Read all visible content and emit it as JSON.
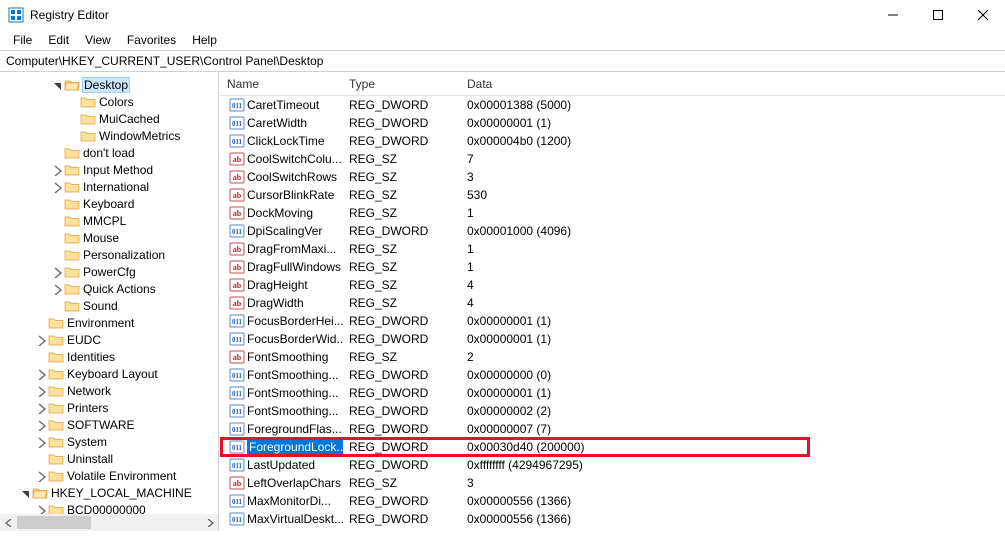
{
  "window": {
    "title": "Registry Editor"
  },
  "menu": {
    "file": "File",
    "edit": "Edit",
    "view": "View",
    "favorites": "Favorites",
    "help": "Help"
  },
  "address": "Computer\\HKEY_CURRENT_USER\\Control Panel\\Desktop",
  "list_header": {
    "name": "Name",
    "type": "Type",
    "data": "Data"
  },
  "tree": [
    {
      "depth": 3,
      "label": "Desktop",
      "expand": "open",
      "sel": true
    },
    {
      "depth": 4,
      "label": "Colors",
      "expand": ""
    },
    {
      "depth": 4,
      "label": "MuiCached",
      "expand": ""
    },
    {
      "depth": 4,
      "label": "WindowMetrics",
      "expand": ""
    },
    {
      "depth": 3,
      "label": "don't load",
      "expand": ""
    },
    {
      "depth": 3,
      "label": "Input Method",
      "expand": "closed"
    },
    {
      "depth": 3,
      "label": "International",
      "expand": "closed"
    },
    {
      "depth": 3,
      "label": "Keyboard",
      "expand": ""
    },
    {
      "depth": 3,
      "label": "MMCPL",
      "expand": ""
    },
    {
      "depth": 3,
      "label": "Mouse",
      "expand": ""
    },
    {
      "depth": 3,
      "label": "Personalization",
      "expand": ""
    },
    {
      "depth": 3,
      "label": "PowerCfg",
      "expand": "closed"
    },
    {
      "depth": 3,
      "label": "Quick Actions",
      "expand": "closed"
    },
    {
      "depth": 3,
      "label": "Sound",
      "expand": ""
    },
    {
      "depth": 2,
      "label": "Environment",
      "expand": ""
    },
    {
      "depth": 2,
      "label": "EUDC",
      "expand": "closed"
    },
    {
      "depth": 2,
      "label": "Identities",
      "expand": ""
    },
    {
      "depth": 2,
      "label": "Keyboard Layout",
      "expand": "closed"
    },
    {
      "depth": 2,
      "label": "Network",
      "expand": "closed"
    },
    {
      "depth": 2,
      "label": "Printers",
      "expand": "closed"
    },
    {
      "depth": 2,
      "label": "SOFTWARE",
      "expand": "closed"
    },
    {
      "depth": 2,
      "label": "System",
      "expand": "closed"
    },
    {
      "depth": 2,
      "label": "Uninstall",
      "expand": ""
    },
    {
      "depth": 2,
      "label": "Volatile Environment",
      "expand": "closed"
    },
    {
      "depth": 1,
      "label": "HKEY_LOCAL_MACHINE",
      "expand": "open"
    },
    {
      "depth": 2,
      "label": "BCD00000000",
      "expand": "closed",
      "cut": true
    }
  ],
  "values": [
    {
      "icon": "bin",
      "name": "CaretTimeout",
      "type": "REG_DWORD",
      "data": "0x00001388 (5000)"
    },
    {
      "icon": "bin",
      "name": "CaretWidth",
      "type": "REG_DWORD",
      "data": "0x00000001 (1)"
    },
    {
      "icon": "bin",
      "name": "ClickLockTime",
      "type": "REG_DWORD",
      "data": "0x000004b0 (1200)"
    },
    {
      "icon": "str",
      "name": "CoolSwitchColu...",
      "type": "REG_SZ",
      "data": "7"
    },
    {
      "icon": "str",
      "name": "CoolSwitchRows",
      "type": "REG_SZ",
      "data": "3"
    },
    {
      "icon": "str",
      "name": "CursorBlinkRate",
      "type": "REG_SZ",
      "data": "530"
    },
    {
      "icon": "str",
      "name": "DockMoving",
      "type": "REG_SZ",
      "data": "1"
    },
    {
      "icon": "bin",
      "name": "DpiScalingVer",
      "type": "REG_DWORD",
      "data": "0x00001000 (4096)"
    },
    {
      "icon": "str",
      "name": "DragFromMaxi...",
      "type": "REG_SZ",
      "data": "1"
    },
    {
      "icon": "str",
      "name": "DragFullWindows",
      "type": "REG_SZ",
      "data": "1"
    },
    {
      "icon": "str",
      "name": "DragHeight",
      "type": "REG_SZ",
      "data": "4"
    },
    {
      "icon": "str",
      "name": "DragWidth",
      "type": "REG_SZ",
      "data": "4"
    },
    {
      "icon": "bin",
      "name": "FocusBorderHei...",
      "type": "REG_DWORD",
      "data": "0x00000001 (1)"
    },
    {
      "icon": "bin",
      "name": "FocusBorderWid...",
      "type": "REG_DWORD",
      "data": "0x00000001 (1)"
    },
    {
      "icon": "str",
      "name": "FontSmoothing",
      "type": "REG_SZ",
      "data": "2"
    },
    {
      "icon": "bin",
      "name": "FontSmoothing...",
      "type": "REG_DWORD",
      "data": "0x00000000 (0)"
    },
    {
      "icon": "bin",
      "name": "FontSmoothing...",
      "type": "REG_DWORD",
      "data": "0x00000001 (1)"
    },
    {
      "icon": "bin",
      "name": "FontSmoothing...",
      "type": "REG_DWORD",
      "data": "0x00000002 (2)"
    },
    {
      "icon": "bin",
      "name": "ForegroundFlas...",
      "type": "REG_DWORD",
      "data": "0x00000007 (7)"
    },
    {
      "icon": "bin",
      "name": "ForegroundLock...",
      "type": "REG_DWORD",
      "data": "0x00030d40 (200000)",
      "sel": true,
      "hl": true
    },
    {
      "icon": "bin",
      "name": "LastUpdated",
      "type": "REG_DWORD",
      "data": "0xffffffff (4294967295)"
    },
    {
      "icon": "str",
      "name": "LeftOverlapChars",
      "type": "REG_SZ",
      "data": "3"
    },
    {
      "icon": "bin",
      "name": "MaxMonitorDi...",
      "type": "REG_DWORD",
      "data": "0x00000556 (1366)"
    },
    {
      "icon": "bin",
      "name": "MaxVirtualDeskt...",
      "type": "REG_DWORD",
      "data": "0x00000556 (1366)",
      "cut": true
    }
  ]
}
